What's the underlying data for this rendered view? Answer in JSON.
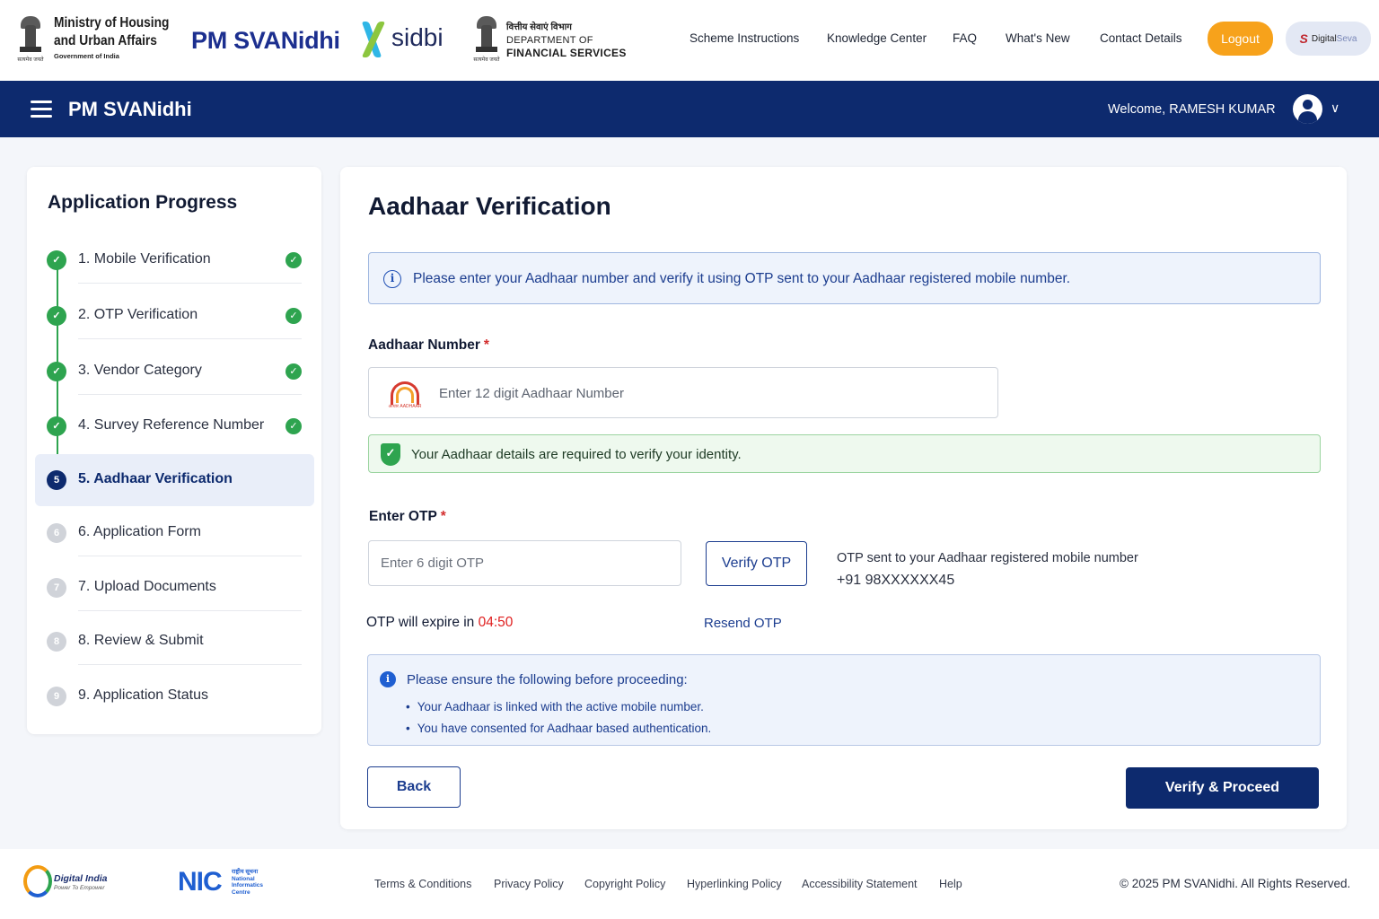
{
  "header": {
    "ministry_line1": "Ministry of Housing",
    "ministry_line2": "and Urban Affairs",
    "ministry_line3": "Government of India",
    "emblem_tagline": "सत्यमेव जयते",
    "pm_svanidhi_logo": "PM SVANidhi",
    "sidbi_logo": "sidbi",
    "dfs_hindi": "वित्तीय सेवाएं विभाग",
    "dfs_line1": "DEPARTMENT OF",
    "dfs_line2": "FINANCIAL SERVICES",
    "nav": [
      "Scheme Instructions",
      "Knowledge Center",
      "FAQ",
      "What's New",
      "Contact Details"
    ],
    "logout_label": "Logout",
    "digital_seva_a": "Digital",
    "digital_seva_b": "Seva"
  },
  "bluebar": {
    "title": "PM SVANidhi",
    "welcome": "Welcome, RAMESH KUMAR"
  },
  "progress": {
    "title": "Application Progress",
    "steps": [
      {
        "num": "1",
        "label": "1. Mobile Verification",
        "status": "done"
      },
      {
        "num": "2",
        "label": "2. OTP Verification",
        "status": "done"
      },
      {
        "num": "3",
        "label": "3. Vendor Category",
        "status": "done"
      },
      {
        "num": "4",
        "label": "4. Survey Reference Number",
        "status": "done"
      },
      {
        "num": "5",
        "label": "5. Aadhaar Verification",
        "status": "active"
      },
      {
        "num": "6",
        "label": "6. Application Form",
        "status": "pending"
      },
      {
        "num": "7",
        "label": "7. Upload Documents",
        "status": "pending"
      },
      {
        "num": "8",
        "label": "8. Review & Submit",
        "status": "pending"
      },
      {
        "num": "9",
        "label": "9. Application Status",
        "status": "pending"
      }
    ]
  },
  "main": {
    "title": "Aadhaar Verification",
    "info_text": "Please enter your Aadhaar number and verify it using OTP sent to your Aadhaar registered mobile number.",
    "aadhaar_label": "Aadhaar Number",
    "required_mark": "*",
    "aadhaar_placeholder": "Enter 12 digit Aadhaar Number",
    "aadhaar_value": "",
    "aadhaar_logo_text": "आधार AADHAAR",
    "success_text": "Your Aadhaar details are required to verify your identity.",
    "otp_label": "Enter OTP",
    "otp_placeholder": "Enter 6 digit OTP",
    "otp_value": "",
    "verify_otp_label": "Verify OTP",
    "otp_sent_text": "OTP sent to your Aadhaar registered mobile number",
    "otp_mobile": "+91 98XXXXXX45",
    "expire_text": "OTP will expire in",
    "timer": "04:50",
    "resend_label": "Resend OTP",
    "note_heading": "Please ensure the following before proceeding:",
    "note_items": [
      "Your Aadhaar is linked with the active mobile number.",
      "You have consented for Aadhaar based authentication."
    ],
    "back_label": "Back",
    "proceed_label": "Verify & Proceed"
  },
  "footer": {
    "digital_india": "Digital India",
    "digital_india_tag": "Power To Empower",
    "nic_logo": "NIC",
    "nic_text_hi": "राष्ट्रीय सूचना",
    "nic_text_1": "National",
    "nic_text_2": "Informatics",
    "nic_text_3": "Centre",
    "links": [
      "Terms & Conditions",
      "Privacy Policy",
      "Copyright Policy",
      "Hyperlinking Policy",
      "Accessibility Statement",
      "Help"
    ],
    "copyright": "© 2025 PM SVANidhi. All Rights Reserved."
  },
  "colors": {
    "primary": "#0d2a6e",
    "accent": "#f7a21b",
    "success": "#2ea44f",
    "timer": "#e02020"
  },
  "icons": [
    "emblem-icon",
    "hamburger-icon",
    "user-avatar-icon",
    "chevron-down-icon",
    "info-icon",
    "check-icon",
    "shield-check-icon",
    "aadhaar-logo-icon"
  ]
}
